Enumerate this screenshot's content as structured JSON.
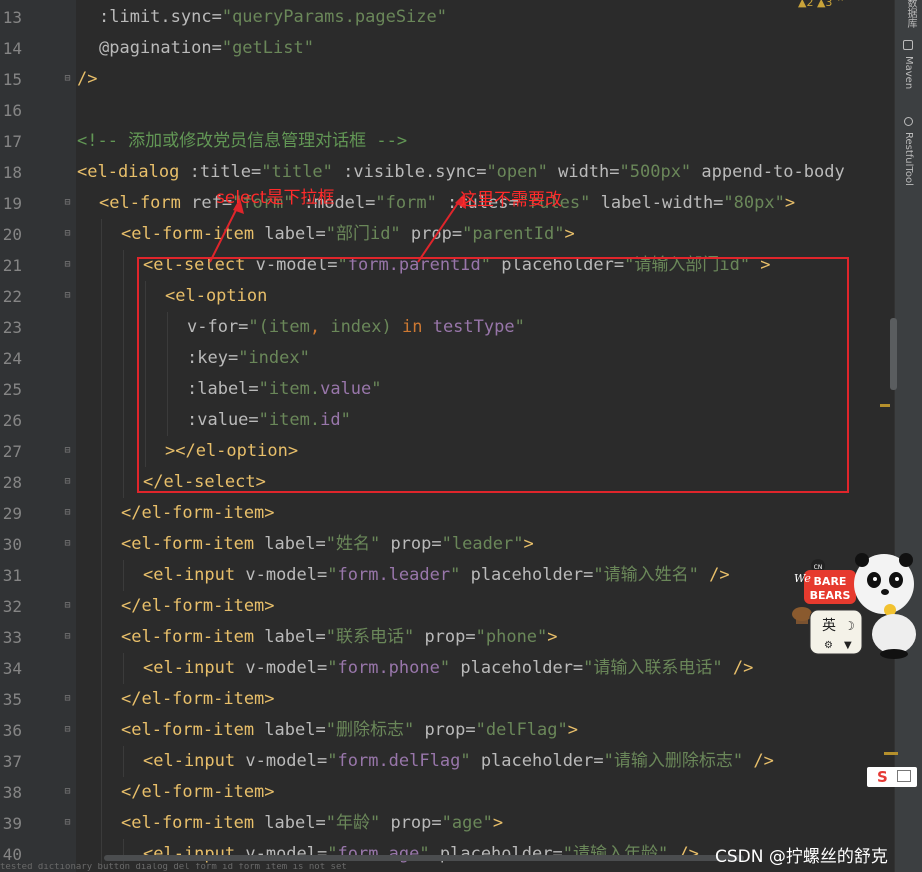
{
  "editor": {
    "lines": [
      {
        "n": "13",
        "indent": 1,
        "t": [
          [
            ":limit.sync=",
            "at"
          ],
          [
            "\"queryParams.pageSize\"",
            "st"
          ]
        ]
      },
      {
        "n": "14",
        "indent": 1,
        "t": [
          [
            "@pagination=",
            "at"
          ],
          [
            "\"getList\"",
            "st"
          ]
        ]
      },
      {
        "n": "15",
        "indent": 0,
        "t": [
          [
            "/>",
            "tg"
          ]
        ]
      },
      {
        "n": "16",
        "indent": 0,
        "t": []
      },
      {
        "n": "17",
        "indent": 0,
        "t": [
          [
            "<!-- 添加或修改党员信息管理对话框 -->",
            "cm"
          ]
        ]
      },
      {
        "n": "18",
        "indent": 0,
        "t": [
          [
            "<el-dialog ",
            "tg"
          ],
          [
            ":title=",
            "at"
          ],
          [
            "\"title\" ",
            "st"
          ],
          [
            ":visible.sync=",
            "at"
          ],
          [
            "\"open\" ",
            "st"
          ],
          [
            "width=",
            "at"
          ],
          [
            "\"500px\" ",
            "st"
          ],
          [
            "append-to-body",
            "at"
          ]
        ]
      },
      {
        "n": "19",
        "indent": 1,
        "t": [
          [
            "<el-form ",
            "tg"
          ],
          [
            "ref=",
            "at"
          ],
          [
            "\"form\" ",
            "st"
          ],
          [
            ":model=",
            "at"
          ],
          [
            "\"form\" ",
            "st"
          ],
          [
            ":rules=",
            "at"
          ],
          [
            "\"rules\" ",
            "st"
          ],
          [
            "label-width=",
            "at"
          ],
          [
            "\"80px\"",
            "st"
          ],
          [
            ">",
            "tg"
          ]
        ]
      },
      {
        "n": "20",
        "indent": 2,
        "t": [
          [
            "<el-form-item ",
            "tg"
          ],
          [
            "label=",
            "at"
          ],
          [
            "\"部门id\" ",
            "st"
          ],
          [
            "prop=",
            "at"
          ],
          [
            "\"parentId\"",
            "st"
          ],
          [
            ">",
            "tg"
          ]
        ]
      },
      {
        "n": "21",
        "indent": 3,
        "t": [
          [
            "<el-select ",
            "tg"
          ],
          [
            "v-model=",
            "at"
          ],
          [
            "\"",
            "st"
          ],
          [
            "form.parentId",
            "pu"
          ],
          [
            "\" ",
            "st"
          ],
          [
            "placeholder=",
            "at"
          ],
          [
            "\"请输入部门id\" ",
            "st"
          ],
          [
            ">",
            "tg"
          ]
        ]
      },
      {
        "n": "22",
        "indent": 4,
        "t": [
          [
            "<el-option",
            "tg"
          ]
        ]
      },
      {
        "n": "23",
        "indent": 5,
        "t": [
          [
            "v-for=",
            "at"
          ],
          [
            "\"(item",
            "st"
          ],
          [
            ", ",
            "kw"
          ],
          [
            "index) ",
            "st"
          ],
          [
            "in ",
            "kw"
          ],
          [
            "testType",
            "pu"
          ],
          [
            "\"",
            "st"
          ]
        ]
      },
      {
        "n": "24",
        "indent": 5,
        "t": [
          [
            ":key=",
            "at"
          ],
          [
            "\"index\"",
            "st"
          ]
        ]
      },
      {
        "n": "25",
        "indent": 5,
        "t": [
          [
            ":label=",
            "at"
          ],
          [
            "\"item.",
            "st"
          ],
          [
            "value",
            "pu"
          ],
          [
            "\"",
            "st"
          ]
        ]
      },
      {
        "n": "26",
        "indent": 5,
        "t": [
          [
            ":value=",
            "at"
          ],
          [
            "\"item.",
            "st"
          ],
          [
            "id",
            "pu"
          ],
          [
            "\"",
            "st"
          ]
        ]
      },
      {
        "n": "27",
        "indent": 4,
        "t": [
          [
            "></el-option>",
            "tg"
          ]
        ]
      },
      {
        "n": "28",
        "indent": 3,
        "t": [
          [
            "</el-select>",
            "tg"
          ]
        ]
      },
      {
        "n": "29",
        "indent": 2,
        "t": [
          [
            "</el-form-item>",
            "tg"
          ]
        ]
      },
      {
        "n": "30",
        "indent": 2,
        "t": [
          [
            "<el-form-item ",
            "tg"
          ],
          [
            "label=",
            "at"
          ],
          [
            "\"姓名\" ",
            "st"
          ],
          [
            "prop=",
            "at"
          ],
          [
            "\"leader\"",
            "st"
          ],
          [
            ">",
            "tg"
          ]
        ]
      },
      {
        "n": "31",
        "indent": 3,
        "t": [
          [
            "<el-input ",
            "tg"
          ],
          [
            "v-model=",
            "at"
          ],
          [
            "\"",
            "st"
          ],
          [
            "form.leader",
            "pu"
          ],
          [
            "\" ",
            "st"
          ],
          [
            "placeholder=",
            "at"
          ],
          [
            "\"请输入姓名\" ",
            "st"
          ],
          [
            "/>",
            "tg"
          ]
        ]
      },
      {
        "n": "32",
        "indent": 2,
        "t": [
          [
            "</el-form-item>",
            "tg"
          ]
        ]
      },
      {
        "n": "33",
        "indent": 2,
        "t": [
          [
            "<el-form-item ",
            "tg"
          ],
          [
            "label=",
            "at"
          ],
          [
            "\"联系电话\" ",
            "st"
          ],
          [
            "prop=",
            "at"
          ],
          [
            "\"phone\"",
            "st"
          ],
          [
            ">",
            "tg"
          ]
        ]
      },
      {
        "n": "34",
        "indent": 3,
        "t": [
          [
            "<el-input ",
            "tg"
          ],
          [
            "v-model=",
            "at"
          ],
          [
            "\"",
            "st"
          ],
          [
            "form.phone",
            "pu"
          ],
          [
            "\" ",
            "st"
          ],
          [
            "placeholder=",
            "at"
          ],
          [
            "\"请输入联系电话\" ",
            "st"
          ],
          [
            "/>",
            "tg"
          ]
        ]
      },
      {
        "n": "35",
        "indent": 2,
        "t": [
          [
            "</el-form-item>",
            "tg"
          ]
        ]
      },
      {
        "n": "36",
        "indent": 2,
        "t": [
          [
            "<el-form-item ",
            "tg"
          ],
          [
            "label=",
            "at"
          ],
          [
            "\"删除标志\" ",
            "st"
          ],
          [
            "prop=",
            "at"
          ],
          [
            "\"delFlag\"",
            "st"
          ],
          [
            ">",
            "tg"
          ]
        ]
      },
      {
        "n": "37",
        "indent": 3,
        "t": [
          [
            "<el-input ",
            "tg"
          ],
          [
            "v-model=",
            "at"
          ],
          [
            "\"",
            "st"
          ],
          [
            "form.delFlag",
            "pu"
          ],
          [
            "\" ",
            "st"
          ],
          [
            "placeholder=",
            "at"
          ],
          [
            "\"请输入删除标志\" ",
            "st"
          ],
          [
            "/>",
            "tg"
          ]
        ]
      },
      {
        "n": "38",
        "indent": 2,
        "t": [
          [
            "</el-form-item>",
            "tg"
          ]
        ]
      },
      {
        "n": "39",
        "indent": 2,
        "t": [
          [
            "<el-form-item ",
            "tg"
          ],
          [
            "label=",
            "at"
          ],
          [
            "\"年龄\" ",
            "st"
          ],
          [
            "prop=",
            "at"
          ],
          [
            "\"age\"",
            "st"
          ],
          [
            ">",
            "tg"
          ]
        ]
      },
      {
        "n": "40",
        "indent": 3,
        "t": [
          [
            "<el-input ",
            "tg"
          ],
          [
            "v-model=",
            "at"
          ],
          [
            "\"",
            "st"
          ],
          [
            "form.age",
            "pu"
          ],
          [
            "\" ",
            "st"
          ],
          [
            "placeholder=",
            "at"
          ],
          [
            "\"请输入年龄\" ",
            "st"
          ],
          [
            "/>",
            "tg"
          ]
        ]
      }
    ],
    "fold_markers": [
      "15",
      "19",
      "20",
      "21",
      "22",
      "27",
      "28",
      "29",
      "30",
      "32",
      "33",
      "35",
      "36",
      "38",
      "39"
    ]
  },
  "annotations": {
    "note_select": "select是下拉框",
    "note_no_change": "这里不需要改"
  },
  "right_sidebar": {
    "tabs": [
      "数据库",
      "Maven",
      "RestfulTool"
    ]
  },
  "inspections": {
    "warnings_label": "▲2 ▲3 ⌃"
  },
  "sticker": {
    "text_top": "We BARE BEARS",
    "ime_label": "英",
    "s_badge": "S"
  },
  "watermark": "CSDN @拧螺丝的舒克",
  "colors": {
    "background": "#2b2b2b",
    "tag": "#e8bf6a",
    "attribute": "#bababa",
    "string": "#6a8759",
    "comment": "#629755",
    "highlight_box": "#e0252b",
    "annotation_text": "#ff2a2a"
  }
}
